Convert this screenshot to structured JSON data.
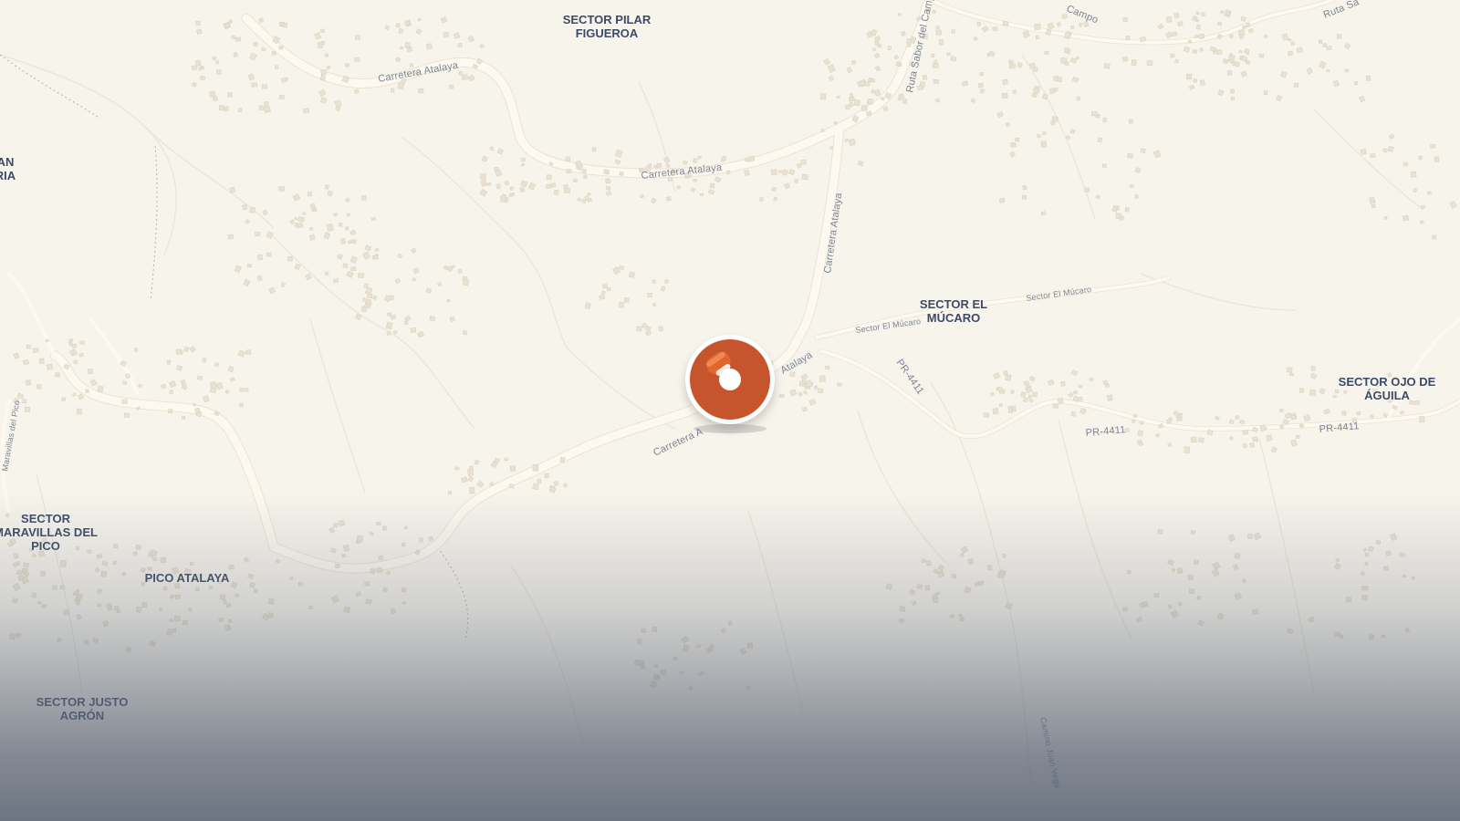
{
  "map": {
    "colors": {
      "land": "#f7f4ec",
      "road": "#fdf9f0",
      "label_place": "#3b4a66",
      "label_road": "#7c8492",
      "marker": "#c6542d"
    },
    "place_labels": [
      {
        "id": "pilar",
        "text": "SECTOR PILAR\nFIGUEROA"
      },
      {
        "id": "mucaro",
        "text": "SECTOR EL\nMÚCARO"
      },
      {
        "id": "ojo",
        "text": "SECTOR OJO DE\nÁGUILA"
      },
      {
        "id": "maravillas",
        "text": "SECTOR\nMARAVILLAS DEL\nPICO"
      },
      {
        "id": "atalaya-peak",
        "text": "PICO ATALAYA"
      },
      {
        "id": "justo",
        "text": "SECTOR JUSTO\nAGRÓN"
      },
      {
        "id": "left-edge",
        "text": "AN\nRIA"
      }
    ],
    "road_labels": [
      {
        "id": "r1",
        "text": "Carretera Atalaya"
      },
      {
        "id": "r2",
        "text": "Carretera Atalaya"
      },
      {
        "id": "r3",
        "text": "Carretera Atalaya"
      },
      {
        "id": "r4",
        "text": "Atalaya"
      },
      {
        "id": "r5",
        "text": "Carretera A"
      },
      {
        "id": "r6",
        "text": "Ruta Sabor del Campo"
      },
      {
        "id": "r7",
        "text": "Campo"
      },
      {
        "id": "r8",
        "text": "Ruta Sa"
      },
      {
        "id": "r9",
        "text": "Sector El Múcaro"
      },
      {
        "id": "r10",
        "text": "Sector El Múcaro"
      },
      {
        "id": "r11",
        "text": "PR-4411"
      },
      {
        "id": "r12",
        "text": "PR-4411"
      },
      {
        "id": "r13",
        "text": "PR-4411"
      },
      {
        "id": "r14",
        "text": "Camino Juan Vega"
      },
      {
        "id": "r15",
        "text": "Maravillas del Pico"
      }
    ],
    "marker": {
      "icon": "location-pin-icon"
    }
  }
}
